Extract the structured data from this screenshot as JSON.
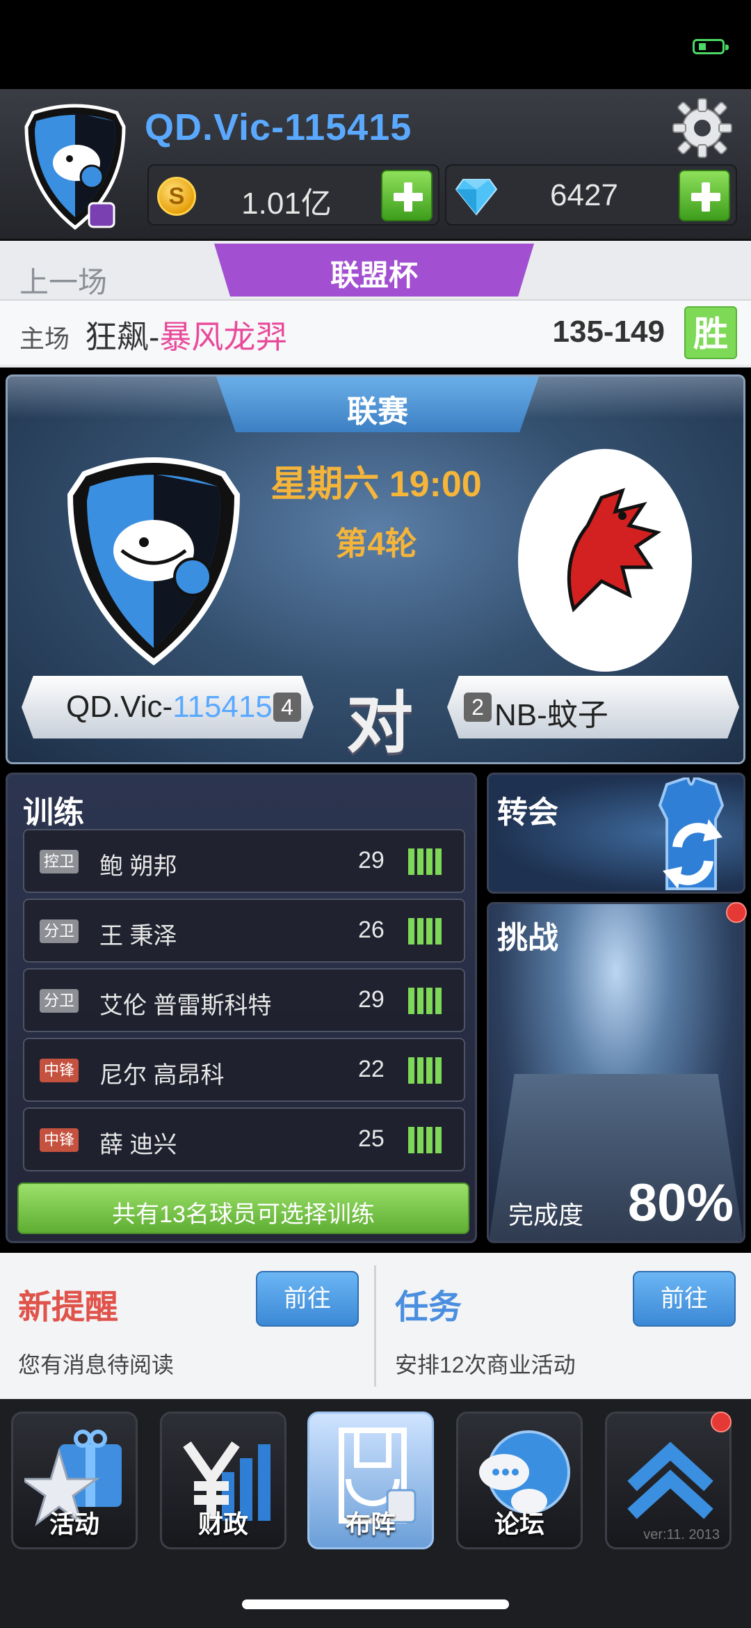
{
  "header": {
    "player_name": "QD.Vic-115415",
    "coins": "1.01亿",
    "coin_symbol": "S",
    "gems": "6427"
  },
  "last_match": {
    "label": "上一场",
    "competition": "联盟杯",
    "home_label": "主场",
    "opponent_prefix": "狂飙-",
    "opponent_highlight": "暴风龙羿",
    "score": "135-149",
    "result": "胜"
  },
  "fixture": {
    "competition": "联赛",
    "time": "星期六 19:00",
    "round": "第4轮",
    "vs": "对",
    "home": {
      "name_prefix": "QD.Vic-",
      "name_highlight": "115415",
      "rank": "4"
    },
    "away": {
      "name": "NB-蚊子",
      "rank": "2"
    }
  },
  "training": {
    "title": "训练",
    "players": [
      {
        "position": "控卫",
        "name": "鲍 朔邦",
        "age": "29",
        "stamina_bars": 4
      },
      {
        "position": "分卫",
        "name": "王 秉泽",
        "age": "26",
        "stamina_bars": 4
      },
      {
        "position": "分卫",
        "name": "艾伦 普雷斯科特",
        "age": "29",
        "stamina_bars": 4
      },
      {
        "position": "中锋",
        "name": "尼尔 高昂科",
        "age": "22",
        "stamina_bars": 4
      },
      {
        "position": "中锋",
        "name": "薛 迪兴",
        "age": "25",
        "stamina_bars": 4
      }
    ],
    "button_label": "共有13名球员可选择训练"
  },
  "transfer": {
    "title": "转会"
  },
  "challenge": {
    "title": "挑战",
    "completion_label": "完成度",
    "completion_value": "80%"
  },
  "notices": {
    "left": {
      "title": "新提醒",
      "button": "前往",
      "desc": "您有消息待阅读"
    },
    "right": {
      "title": "任务",
      "button": "前往",
      "desc": "安排12次商业活动"
    }
  },
  "nav": {
    "items": [
      {
        "label": "活动",
        "icon": "gift-star-icon"
      },
      {
        "label": "财政",
        "icon": "yen-chart-icon"
      },
      {
        "label": "布阵",
        "icon": "court-lineup-icon",
        "active": true
      },
      {
        "label": "论坛",
        "icon": "globe-chat-icon"
      },
      {
        "label": "",
        "icon": "chevron-up-icon"
      }
    ],
    "version": "ver:11. 2013"
  },
  "colors": {
    "accent_blue": "#5aa9ff",
    "win_green": "#7ed957",
    "cup_purple": "#a24fd1",
    "time_orange": "#f5b43a",
    "alert_red": "#e0534a"
  }
}
